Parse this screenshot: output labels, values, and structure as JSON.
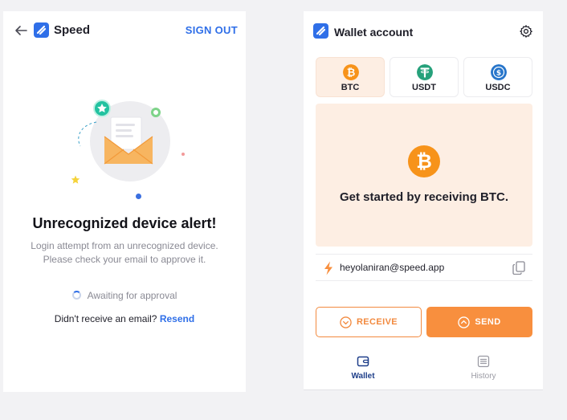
{
  "colors": {
    "brand_blue": "#2f6fe8",
    "accent_orange": "#f88f3e",
    "btc_orange": "#f7931a",
    "usdt_green": "#26a17b",
    "usdc_blue": "#2775ca",
    "hero_bg": "#fdeee3"
  },
  "left_panel": {
    "brand": "Speed",
    "sign_out_label": "SIGN OUT",
    "alert_title": "Unrecognized device alert!",
    "alert_desc_line1": "Login attempt from an unrecognized device.",
    "alert_desc_line2": "Please check your email to approve it.",
    "awaiting_text": "Awaiting for approval",
    "resend_prompt": "Didn't receive an email?",
    "resend_label": "Resend",
    "icons": [
      "back-arrow-icon",
      "speed-logo-icon",
      "envelope-icon",
      "spinner-icon"
    ]
  },
  "right_panel": {
    "title": "Wallet account",
    "currencies": [
      {
        "label": "BTC",
        "icon": "bitcoin-icon",
        "selected": true
      },
      {
        "label": "USDT",
        "icon": "tether-icon",
        "selected": false
      },
      {
        "label": "USDC",
        "icon": "usdc-icon",
        "selected": false
      }
    ],
    "hero_text": "Get started by receiving BTC.",
    "address": "heyolaniran@speed.app",
    "receive_label": "RECEIVE",
    "send_label": "SEND",
    "nav": [
      {
        "label": "Wallet",
        "icon": "wallet-icon",
        "active": true
      },
      {
        "label": "History",
        "icon": "history-icon",
        "active": false
      }
    ],
    "icons": [
      "settings-gear-icon",
      "lightning-bolt-icon",
      "copy-icon"
    ]
  }
}
